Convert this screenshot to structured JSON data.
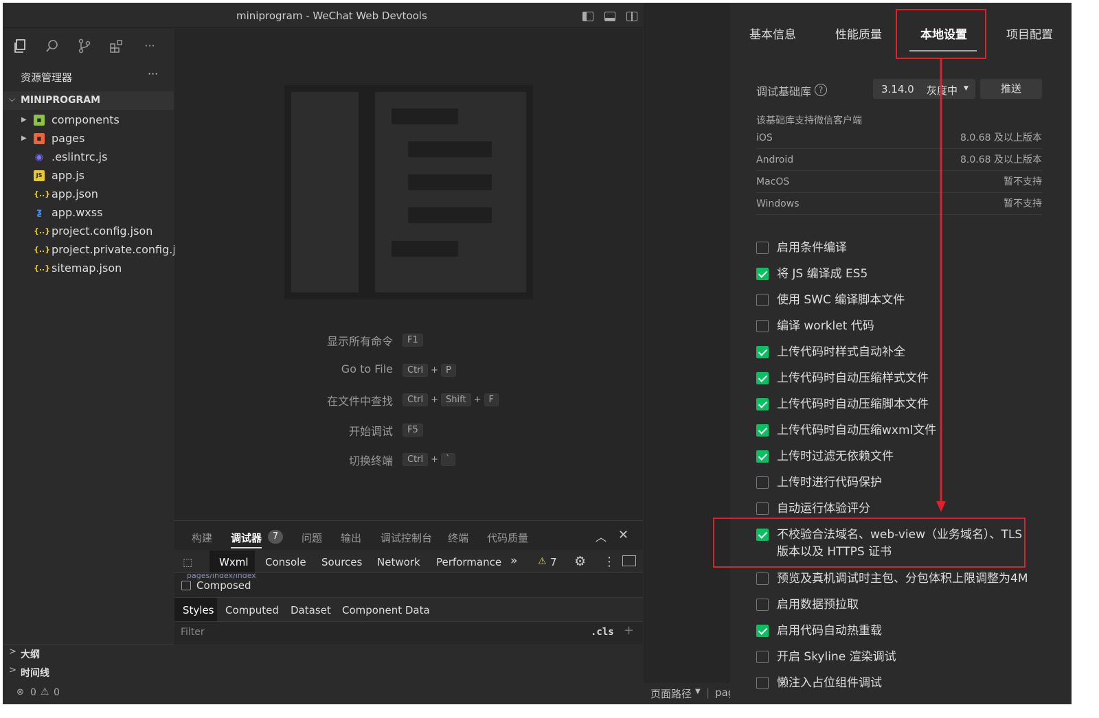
{
  "window": {
    "title": "miniprogram - WeChat Web Devtools"
  },
  "explorer": {
    "header": "资源管理器",
    "more": "···",
    "root": "MINIPROGRAM",
    "items": [
      {
        "label": "components",
        "icon": "folder-components-icon"
      },
      {
        "label": "pages",
        "icon": "folder-pages-icon"
      },
      {
        "label": ".eslintrc.js",
        "icon": "eslint-icon"
      },
      {
        "label": "app.js",
        "icon": "js-file-icon"
      },
      {
        "label": "app.json",
        "icon": "json-file-icon"
      },
      {
        "label": "app.wxss",
        "icon": "css-file-icon"
      },
      {
        "label": "project.config.json",
        "icon": "json-file-icon"
      },
      {
        "label": "project.private.config.js...",
        "icon": "json-file-icon"
      },
      {
        "label": "sitemap.json",
        "icon": "json-file-icon"
      }
    ],
    "outline": "大纲",
    "timeline": "时间线"
  },
  "editor": {
    "commands": [
      {
        "label": "显示所有命令",
        "keys": [
          "F1"
        ]
      },
      {
        "label": "Go to File",
        "keys": [
          "Ctrl",
          "P"
        ]
      },
      {
        "label": "在文件中查找",
        "keys": [
          "Ctrl",
          "Shift",
          "F"
        ]
      },
      {
        "label": "开始调试",
        "keys": [
          "F5"
        ]
      },
      {
        "label": "切换终端",
        "keys": [
          "Ctrl",
          "`"
        ]
      }
    ]
  },
  "panel": {
    "tabs": [
      "构建",
      "调试器",
      "问题",
      "输出",
      "调试控制台",
      "终端",
      "代码质量"
    ],
    "badge": "7",
    "devtools_tabs": [
      "Wxml",
      "Console",
      "Sources",
      "Network",
      "Performance"
    ],
    "more": "»",
    "warning_count": "7",
    "composed": "Composed",
    "style_tabs": [
      "Styles",
      "Computed",
      "Dataset",
      "Component Data"
    ],
    "filter_placeholder": "Filter",
    "cls": ".cls",
    "plus": "+",
    "breadcrumb_fragment": "pages/index/index"
  },
  "status": {
    "errors": "0",
    "warnings": "0",
    "page_path": "页面路径",
    "page_value": "pag"
  },
  "settings": {
    "tabs": [
      "基本信息",
      "性能质量",
      "本地设置",
      "项目配置"
    ],
    "active_tab": "本地设置",
    "lib_label": "调试基础库",
    "lib_version": "3.14.0",
    "lib_status": "灰度中",
    "push": "推送",
    "support_title": "该基础库支持微信客户端",
    "platforms": [
      {
        "name": "iOS",
        "value": "8.0.68 及以上版本"
      },
      {
        "name": "Android",
        "value": "8.0.68 及以上版本"
      },
      {
        "name": "MacOS",
        "value": "暂不支持"
      },
      {
        "name": "Windows",
        "value": "暂不支持"
      }
    ],
    "options": [
      {
        "label": "启用条件编译",
        "checked": false
      },
      {
        "label": "将 JS 编译成 ES5",
        "checked": true
      },
      {
        "label": "使用 SWC 编译脚本文件",
        "checked": false
      },
      {
        "label": "编译 worklet 代码",
        "checked": false
      },
      {
        "label": "上传代码时样式自动补全",
        "checked": true
      },
      {
        "label": "上传代码时自动压缩样式文件",
        "checked": true
      },
      {
        "label": "上传代码时自动压缩脚本文件",
        "checked": true
      },
      {
        "label": "上传代码时自动压缩wxml文件",
        "checked": true
      },
      {
        "label": "上传时过滤无依赖文件",
        "checked": true
      },
      {
        "label": "上传时进行代码保护",
        "checked": false
      },
      {
        "label": "自动运行体验评分",
        "checked": false
      },
      {
        "label": "不校验合法域名、web-view（业务域名）、TLS 版本以及 HTTPS 证书",
        "checked": true
      },
      {
        "label": "预览及真机调试时主包、分包体积上限调整为4M",
        "checked": false
      },
      {
        "label": "启用数据预拉取",
        "checked": false
      },
      {
        "label": "启用代码自动热重载",
        "checked": true
      },
      {
        "label": "开启 Skyline 渲染调试",
        "checked": false
      },
      {
        "label": "懒注入占位组件调试",
        "checked": false
      }
    ],
    "highlight_line1": "不校验合法域名、web-view（业务域名）、TLS",
    "highlight_line2": "版本以及 HTTPS 证书"
  },
  "colors": {
    "accent": "#07c160",
    "annotation": "#e0202a",
    "bg": "#2b2b2b"
  }
}
